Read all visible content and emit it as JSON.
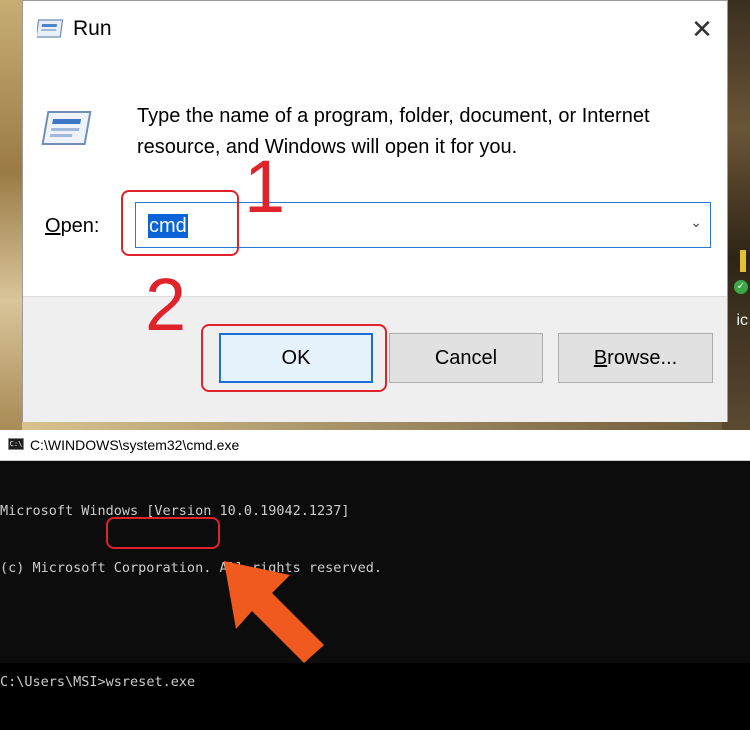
{
  "run_dialog": {
    "title": "Run",
    "close_glyph": "✕",
    "description": "Type the name of a program, folder, document, or Internet resource, and Windows will open it for you.",
    "open_label_prefix": "",
    "open_label_underlined": "O",
    "open_label_rest": "pen:",
    "open_value": "cmd",
    "dropdown_glyph": "⌄",
    "buttons": {
      "ok": "OK",
      "cancel": "Cancel",
      "browse_underlined": "B",
      "browse_rest": "rowse..."
    },
    "icons": {
      "title": "run-icon",
      "main": "run-icon",
      "close": "close-icon",
      "dropdown": "chevron-down-icon"
    }
  },
  "annotations": {
    "step1": "1",
    "step2": "2",
    "color": "#e0222b",
    "arrow_color": "#f15a1f"
  },
  "cmd": {
    "title": "C:\\WINDOWS\\system32\\cmd.exe",
    "lines": [
      "Microsoft Windows [Version 10.0.19042.1237]",
      "(c) Microsoft Corporation. All rights reserved.",
      "",
      "C:\\Users\\MSI>wsreset.exe"
    ],
    "prompt": "C:\\Users\\MSI",
    "command": ">wsreset.exe"
  },
  "desktop": {
    "right_text": "ic"
  }
}
